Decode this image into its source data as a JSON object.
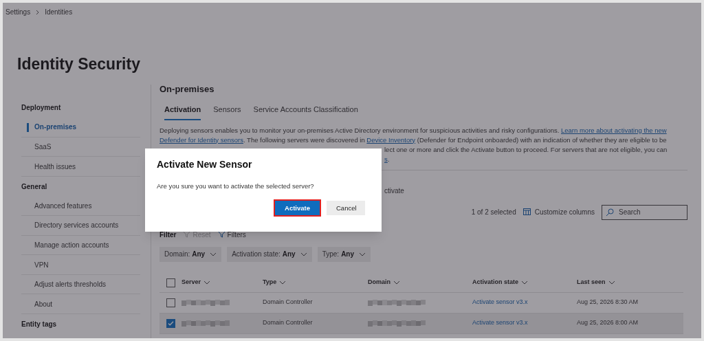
{
  "breadcrumb": [
    "Settings",
    "Identities"
  ],
  "page_title": "Identity Security",
  "sidebar": [
    {
      "heading": "Deployment",
      "items": [
        {
          "label": "On-premises",
          "selected": true
        },
        {
          "label": "SaaS",
          "selected": false
        },
        {
          "label": "Health issues",
          "selected": false
        }
      ]
    },
    {
      "heading": "General",
      "items": [
        {
          "label": "Advanced features",
          "selected": false
        },
        {
          "label": "Directory services accounts",
          "selected": false
        },
        {
          "label": "Manage action accounts",
          "selected": false
        },
        {
          "label": "VPN",
          "selected": false
        },
        {
          "label": "Adjust alerts thresholds",
          "selected": false
        },
        {
          "label": "About",
          "selected": false
        }
      ]
    },
    {
      "heading": "Entity tags"
    }
  ],
  "section_title": "On-premises",
  "tabs": [
    {
      "label": "Activation",
      "selected": true
    },
    {
      "label": "Sensors",
      "selected": false
    },
    {
      "label": "Service Accounts Classification",
      "selected": false
    }
  ],
  "description_lines": [
    [
      {
        "text": "Deploying sensors enables you to monitor your on-premises Active Directory environment for suspicious activities and risky configurations. "
      },
      {
        "text": "Learn more about activating the new",
        "link": true
      }
    ],
    [
      {
        "text": "Defender for Identity sensors",
        "link": true
      },
      {
        "text": ". The following servers were discovered in "
      },
      {
        "text": "Device Inventory",
        "link": true
      },
      {
        "text": " (Defender for Endpoint onboarded) with an indication of whether they are eligible to be"
      }
    ],
    [
      {
        "text": "lect one or more and click the Activate button to proceed. For servers that are not eligible, you can"
      }
    ],
    [
      {
        "text": "s",
        "link": true
      },
      {
        "text": "."
      }
    ]
  ],
  "activate_button_fragment": "ctivate",
  "selection_count": "1 of 2 selected",
  "customize_columns": "Customize columns",
  "search": {
    "placeholder": "Search"
  },
  "filter": {
    "label": "Filter",
    "reset": "Reset",
    "filters": "Filters"
  },
  "filter_chips": [
    {
      "label": "Domain:",
      "value": "Any"
    },
    {
      "label": "Activation state:",
      "value": "Any"
    },
    {
      "label": "Type:",
      "value": "Any"
    }
  ],
  "table": {
    "select_all_checked": false,
    "columns": [
      "Server",
      "Type",
      "Domain",
      "Activation state",
      "Last seen"
    ],
    "rows": [
      {
        "checked": false,
        "type": "Domain Controller",
        "activation_state": "Activate sensor v3.x",
        "last_seen": "Aug 25, 2026 8:30 AM"
      },
      {
        "checked": true,
        "type": "Domain Controller",
        "activation_state": "Activate sensor v3.x",
        "last_seen": "Aug 25, 2026 8:00 AM"
      }
    ]
  },
  "dialog": {
    "title": "Activate New Sensor",
    "message": "Are you sure you want to activate the selected server?",
    "primary": "Activate",
    "secondary": "Cancel"
  }
}
